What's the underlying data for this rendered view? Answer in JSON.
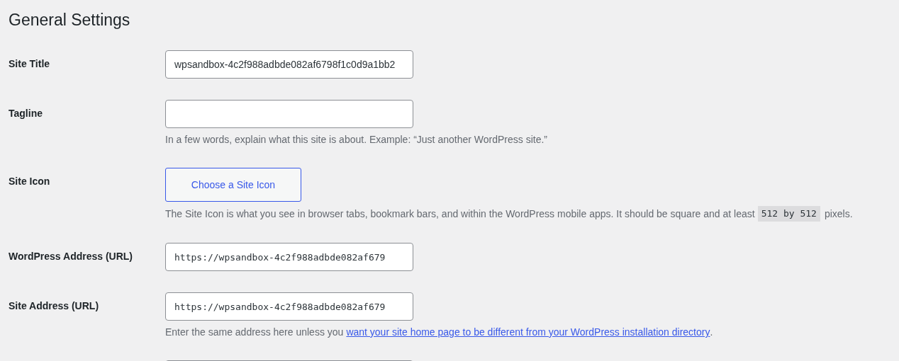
{
  "page_title": "General Settings",
  "rows": [
    {
      "kind": "text",
      "label": "Site Title",
      "value": "wpsandbox-4c2f988adbde082af6798f1c0d9a1bb2"
    },
    {
      "kind": "text",
      "label": "Tagline",
      "description": [
        {
          "kind": "text",
          "text": "In a few words, explain what this site is about. Example: “Just another WordPress site.”"
        }
      ]
    },
    {
      "kind": "button",
      "label": "Site Icon",
      "button": "Choose a Site Icon",
      "description": [
        {
          "kind": "text",
          "text": "The Site Icon is what you see in browser tabs, bookmark bars, and within the WordPress mobile apps. It should be square and at least"
        },
        {
          "kind": "code",
          "text": "512 by 512"
        },
        {
          "kind": "text",
          "text": "pixels."
        }
      ]
    },
    {
      "kind": "url",
      "label": "WordPress Address (URL)",
      "value": "https://wpsandbox-4c2f988adbde082af679"
    },
    {
      "kind": "url",
      "label": "Site Address (URL)",
      "value": "https://wpsandbox-4c2f988adbde082af679",
      "description": [
        {
          "kind": "text",
          "text": "Enter the same address here unless you"
        },
        {
          "kind": "link",
          "text": "want your site home page to be different from your WordPress installation directory"
        },
        {
          "kind": "text",
          "text": ".",
          "attached": true
        }
      ]
    },
    {
      "kind": "text"
    }
  ]
}
